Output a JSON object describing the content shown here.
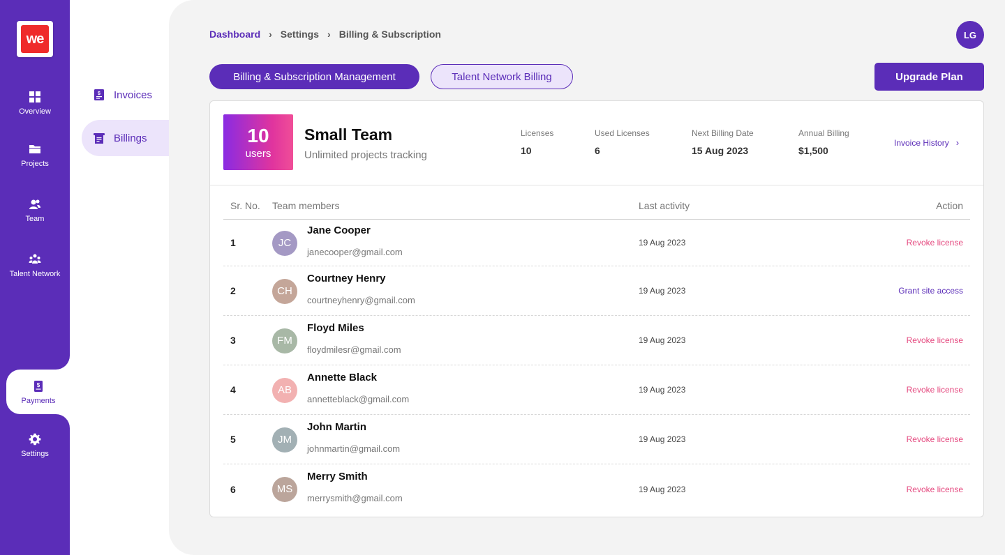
{
  "app": {
    "logo_text": "we"
  },
  "rail": {
    "items": [
      {
        "label": "Overview",
        "icon": "grid-icon"
      },
      {
        "label": "Projects",
        "icon": "folder-icon"
      },
      {
        "label": "Team",
        "icon": "team-icon"
      },
      {
        "label": "Talent Network",
        "icon": "network-icon"
      },
      {
        "label": "Payments",
        "icon": "payment-icon",
        "active": true
      },
      {
        "label": "Settings",
        "icon": "gear-icon"
      }
    ]
  },
  "submenu": {
    "items": [
      {
        "label": "Invoices",
        "icon": "invoice-icon"
      },
      {
        "label": "Billings",
        "icon": "billing-icon",
        "active": true
      }
    ]
  },
  "breadcrumb": [
    "Dashboard",
    "Settings",
    "Billing & Subscription"
  ],
  "user": {
    "initials": "LG"
  },
  "tabs": [
    {
      "label": "Billing & Subscription Management",
      "active": true
    },
    {
      "label": "Talent Network Billing",
      "active": false
    }
  ],
  "upgrade_label": "Upgrade Plan",
  "plan": {
    "count": "10",
    "unit": "users",
    "name": "Small Team",
    "description": "Unlimited projects tracking"
  },
  "stats": [
    {
      "label": "Licenses",
      "value": "10"
    },
    {
      "label": "Used Licenses",
      "value": "6"
    },
    {
      "label": "Next Billing Date",
      "value": "15 Aug 2023"
    },
    {
      "label": "Annual Billing",
      "value": "$1,500"
    }
  ],
  "invoice_history_label": "Invoice History",
  "table": {
    "headers": {
      "no": "Sr. No.",
      "member": "Team members",
      "last": "Last activity",
      "action": "Action"
    },
    "rows": [
      {
        "no": "1",
        "initials": "JC",
        "avatar_color": "#a499c4",
        "name": "Jane Cooper",
        "email": "janecooper@gmail.com",
        "last": "19 Aug 2023",
        "action": "Revoke license",
        "action_type": "revoke"
      },
      {
        "no": "2",
        "initials": "CH",
        "avatar_color": "#c4a699",
        "name": "Courtney Henry",
        "email": "courtneyhenry@gmail.com",
        "last": "19 Aug 2023",
        "action": "Grant site access",
        "action_type": "grant"
      },
      {
        "no": "3",
        "initials": "FM",
        "avatar_color": "#a8b8a6",
        "name": "Floyd Miles",
        "email": "floydmilesr@gmail.com",
        "last": "19 Aug 2023",
        "action": "Revoke license",
        "action_type": "revoke"
      },
      {
        "no": "4",
        "initials": "AB",
        "avatar_color": "#f2b1b1",
        "name": "Annette Black",
        "email": "annetteblack@gmail.com",
        "last": "19 Aug 2023",
        "action": "Revoke license",
        "action_type": "revoke"
      },
      {
        "no": "5",
        "initials": "JM",
        "avatar_color": "#a2b0b4",
        "name": "John Martin",
        "email": "johnmartin@gmail.com",
        "last": "19 Aug 2023",
        "action": "Revoke license",
        "action_type": "revoke"
      },
      {
        "no": "6",
        "initials": "MS",
        "avatar_color": "#bba59b",
        "name": "Merry Smith",
        "email": "merrysmith@gmail.com",
        "last": "19 Aug 2023",
        "action": "Revoke license",
        "action_type": "revoke"
      }
    ]
  },
  "colors": {
    "brand": "#5b2db8",
    "revoke": "#e5497f",
    "background": "#f3f3f3"
  }
}
